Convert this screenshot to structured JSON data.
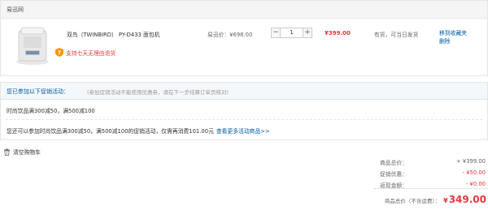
{
  "store": {
    "name": "易迅网"
  },
  "product": {
    "name": "双鸟（TWINBIRD） PY-D433 面包机",
    "guarantee": "支持七天无理由退货",
    "guarantee_icon": "shield-7-icon",
    "unit_price": "易迅价：¥698.00",
    "quantity": "1",
    "minus": "−",
    "plus": "+",
    "row_total": "¥399.00",
    "stock": "有货，可当日发货",
    "op_favorite": "移到收藏夹",
    "op_delete": "删除"
  },
  "promo": {
    "title": "您已参加以下促销活动：",
    "note": "(参加促销活动不能使用优惠券，请在下一步结算订单页核对)",
    "line1": "时尚饮品满300减50，满500减100",
    "line2": "您还可以参加时尚饮品满300减50，满500减100的促销活动，仅需再消费101.00元",
    "more_link": "查看更多活动商品>>"
  },
  "cart": {
    "clear_label": "清空购物车"
  },
  "summary": {
    "goods_total_label": "商品总价：",
    "goods_total": "+ ¥399.00",
    "discount_label": "促销优惠：",
    "discount": "- ¥50.00",
    "refund_label": "返现金额：",
    "refund": "- ¥0.00",
    "grand_label": "商品总价（不含运费）：",
    "grand_currency": "¥",
    "grand_value": "349.00"
  },
  "colors": {
    "accent_red": "#e4393c",
    "link_blue": "#005aa0"
  }
}
